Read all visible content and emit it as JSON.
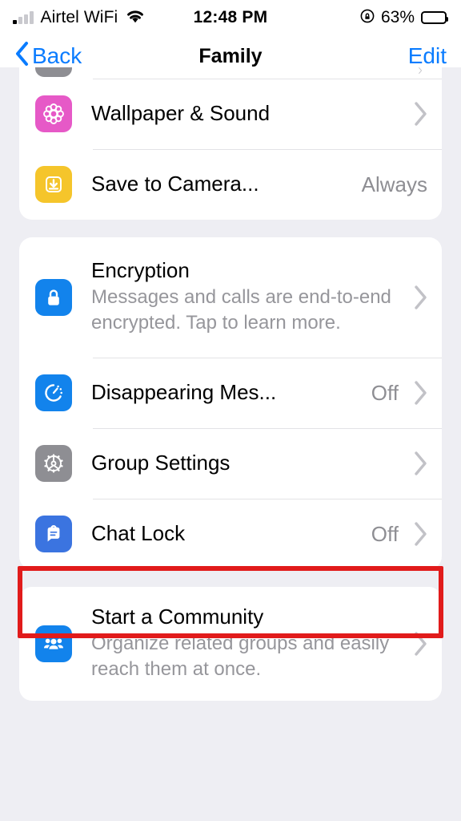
{
  "status_bar": {
    "carrier": "Airtel WiFi",
    "time": "12:48 PM",
    "battery_percent": "63%",
    "wifi_icon": "wifi-icon",
    "signal_icon": "cellular-signal-icon",
    "location_icon": "location-lock-icon",
    "battery_icon": "battery-icon",
    "battery_fill_ratio": 0.65
  },
  "nav_bar": {
    "back_label": "Back",
    "title": "Family",
    "edit_label": "Edit",
    "back_icon": "chevron-left-icon",
    "accent_color": "#0a7cff"
  },
  "sections": [
    {
      "id": "appearance",
      "rows": [
        {
          "id": "cut-off-row",
          "title": "",
          "icon": "partial-gray-icon",
          "icon_color": "#8e8e93",
          "value": "",
          "chevron": true,
          "cut_off": true
        },
        {
          "id": "wallpaper-and-sound",
          "title": "Wallpaper & Sound",
          "icon": "wallpaper-flower-icon",
          "icon_color": "#e659c7",
          "value": "",
          "chevron": true
        },
        {
          "id": "save-to-camera-roll",
          "title": "Save to Camera...",
          "icon": "save-download-icon",
          "icon_color": "#f5c52b",
          "value": "Always",
          "chevron": false
        }
      ]
    },
    {
      "id": "privacy",
      "rows": [
        {
          "id": "encryption",
          "title": "Encryption",
          "subtitle": "Messages and calls are end-to-end encrypted. Tap to learn more.",
          "icon": "lock-icon",
          "icon_color": "#1283ec",
          "value": "",
          "chevron": true
        },
        {
          "id": "disappearing-messages",
          "title": "Disappearing Mes...",
          "icon": "timer-icon",
          "icon_color": "#1283ec",
          "value": "Off",
          "chevron": true
        },
        {
          "id": "group-settings",
          "title": "Group Settings",
          "icon": "gear-icon",
          "icon_color": "#8e8e93",
          "value": "",
          "chevron": true
        },
        {
          "id": "chat-lock",
          "title": "Chat Lock",
          "icon": "chat-lock-icon",
          "icon_color": "#3b74e0",
          "value": "Off",
          "chevron": true,
          "highlighted": true
        }
      ]
    },
    {
      "id": "community",
      "rows": [
        {
          "id": "start-a-community",
          "title": "Start a Community",
          "subtitle": "Organize related groups and easily reach them at once.",
          "icon": "people-group-icon",
          "icon_color": "#1283ec",
          "value": "",
          "chevron": true
        }
      ]
    }
  ],
  "annotation": {
    "target": "chat-lock",
    "color": "#e11b1b",
    "shape": "rectangle"
  }
}
